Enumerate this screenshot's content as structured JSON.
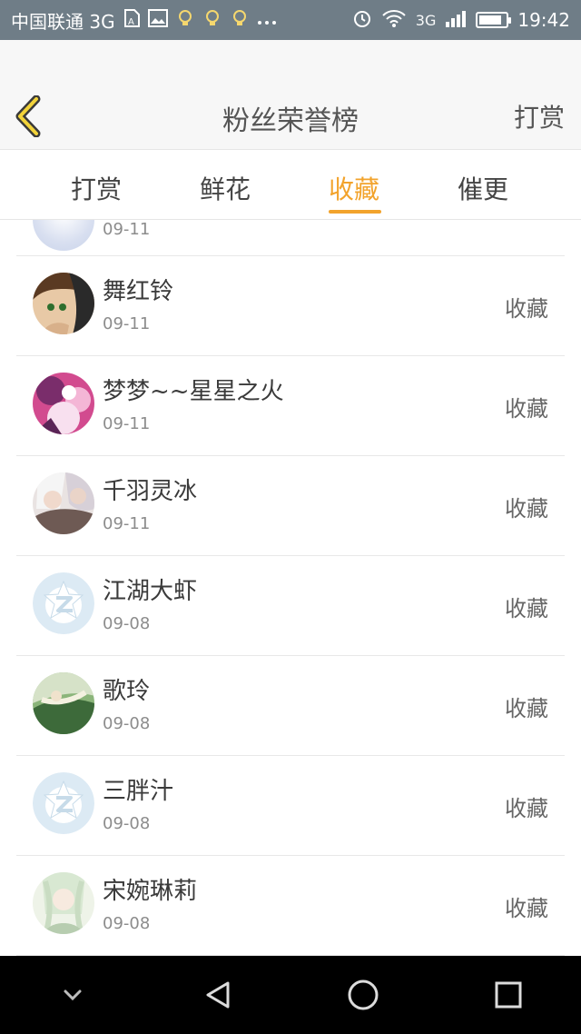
{
  "status_bar": {
    "carrier": "中国联通 3G",
    "network_badge": "3G",
    "time": "19:42",
    "battery_level": 0.85,
    "icons": [
      "sim-icon",
      "image-icon",
      "lightbulb-icon",
      "lightbulb-icon",
      "lightbulb-icon",
      "more-icon",
      "alarm-icon",
      "wifi-icon",
      "signal-icon",
      "battery-icon"
    ]
  },
  "header": {
    "title": "粉丝荣誉榜",
    "right_action": "打赏",
    "back_icon": "chevron-left-icon"
  },
  "tabs": [
    {
      "label": "打赏",
      "active": false
    },
    {
      "label": "鲜花",
      "active": false
    },
    {
      "label": "收藏",
      "active": true
    },
    {
      "label": "催更",
      "active": false
    }
  ],
  "list": {
    "partial_top": {
      "date": "09-11"
    },
    "items": [
      {
        "name": "舞红铃",
        "date": "09-11",
        "action": "收藏",
        "avatar": "anime-girl-avatar"
      },
      {
        "name": "梦梦~~星星之火",
        "date": "09-11",
        "action": "收藏",
        "avatar": "anime-pink-avatar"
      },
      {
        "name": "千羽灵冰",
        "date": "09-11",
        "action": "收藏",
        "avatar": "anime-white-avatar"
      },
      {
        "name": "江湖大虾",
        "date": "09-08",
        "action": "收藏",
        "avatar": "qzone-default-avatar"
      },
      {
        "name": "歌玲",
        "date": "09-08",
        "action": "收藏",
        "avatar": "anime-green-avatar"
      },
      {
        "name": "三胖汁",
        "date": "09-08",
        "action": "收藏",
        "avatar": "qzone-default-avatar"
      },
      {
        "name": "宋婉琳莉",
        "date": "09-08",
        "action": "收藏",
        "avatar": "anime-light-avatar"
      }
    ]
  },
  "nav": {
    "buttons": [
      "chevron-down-icon",
      "back-triangle-icon",
      "home-circle-icon",
      "recents-square-icon"
    ]
  },
  "colors": {
    "accent": "#f2a32c",
    "status_bar": "#6f7d87"
  }
}
